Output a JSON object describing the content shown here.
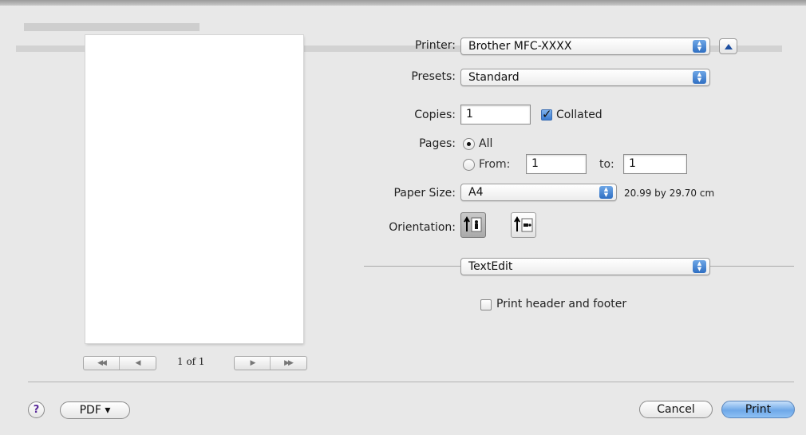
{
  "printer": {
    "label": "Printer:",
    "value": "Brother MFC-XXXX"
  },
  "presets": {
    "label": "Presets:",
    "value": "Standard"
  },
  "copies": {
    "label": "Copies:",
    "value": "1",
    "collated_label": "Collated",
    "collated": true
  },
  "pages": {
    "label": "Pages:",
    "all_label": "All",
    "from_label": "From:",
    "from_value": "1",
    "to_label": "to:",
    "to_value": "1",
    "selected": "All"
  },
  "paper_size": {
    "label": "Paper Size:",
    "value": "A4",
    "dimensions": "20.99 by 29.70 cm"
  },
  "orientation": {
    "label": "Orientation:",
    "selected": "portrait"
  },
  "section": {
    "value": "TextEdit"
  },
  "header_footer": {
    "label": "Print header and footer",
    "checked": false
  },
  "preview": {
    "page_indicator": "1 of 1"
  },
  "buttons": {
    "help": "?",
    "pdf": "PDF ▾",
    "cancel": "Cancel",
    "print": "Print"
  },
  "colors": {
    "accent": "#3a7bd0",
    "background": "#e8e8e8"
  }
}
